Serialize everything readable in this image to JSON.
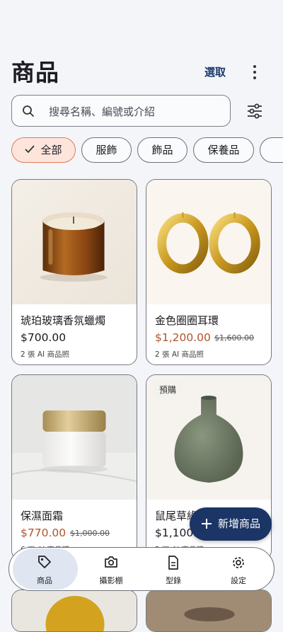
{
  "header": {
    "title": "商品",
    "select_label": "選取"
  },
  "search": {
    "placeholder": "搜尋名稱、編號或介紹",
    "value": ""
  },
  "chips": [
    {
      "label": "全部",
      "active": true
    },
    {
      "label": "服飾"
    },
    {
      "label": "飾品"
    },
    {
      "label": "保養品"
    }
  ],
  "products": [
    {
      "name": "琥珀玻璃香氛蠟燭",
      "price": "$700.00",
      "original": "",
      "meta": "2 張 AI 商品照",
      "badge": ""
    },
    {
      "name": "金色圈圈耳環",
      "price": "$1,200.00",
      "original": "$1,600.00",
      "meta": "2 張 AI 商品照",
      "badge": ""
    },
    {
      "name": "保濕面霜",
      "price": "$770.00",
      "original": "$1,000.00",
      "meta": "6 張 AI 商品照",
      "badge": ""
    },
    {
      "name": "鼠尾草綠",
      "price": "$1,100.",
      "original": "",
      "meta": "2 張 AI 商品照",
      "badge": "預購"
    }
  ],
  "fab": {
    "label": "新增商品"
  },
  "nav": [
    {
      "label": "商品",
      "icon": "tag-icon",
      "active": true
    },
    {
      "label": "攝影棚",
      "icon": "camera-icon"
    },
    {
      "label": "型錄",
      "icon": "document-icon"
    },
    {
      "label": "設定",
      "icon": "gear-icon"
    }
  ],
  "colors": {
    "accent": "#1b3566",
    "sale": "#b2532c",
    "chip_active_bg": "#fde5dc"
  }
}
